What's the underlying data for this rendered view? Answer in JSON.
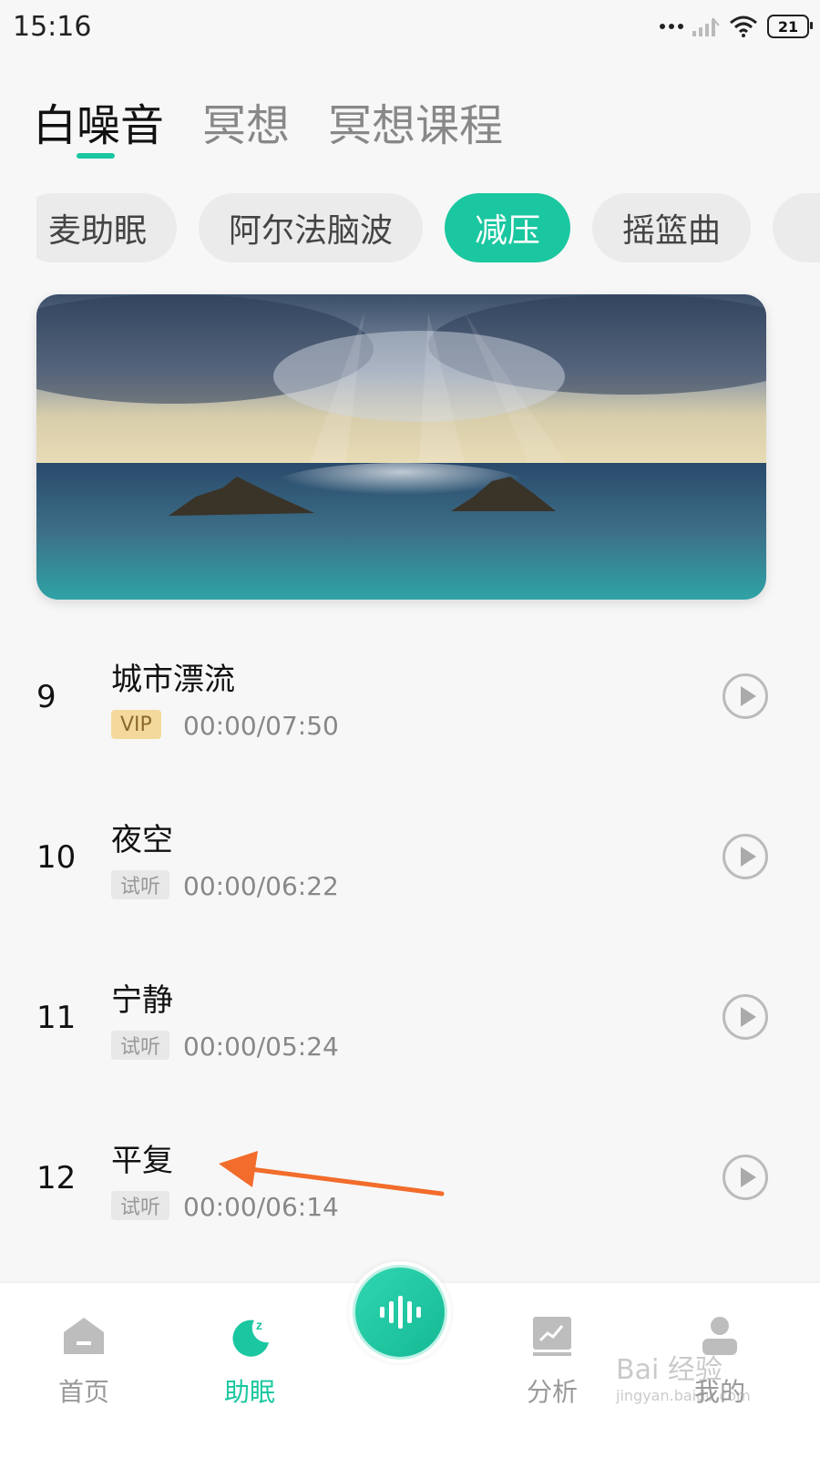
{
  "status_bar": {
    "time": "15:16",
    "battery": "21"
  },
  "top_tabs": [
    {
      "label": "白噪音",
      "active": true
    },
    {
      "label": "冥想",
      "active": false
    },
    {
      "label": "冥想课程",
      "active": false
    }
  ],
  "categories": [
    {
      "label": "麦助眠",
      "active": false
    },
    {
      "label": "阿尔法脑波",
      "active": false
    },
    {
      "label": "减压",
      "active": true
    },
    {
      "label": "摇篮曲",
      "active": false
    },
    {
      "label": "",
      "active": false
    }
  ],
  "tracks": [
    {
      "number": "9",
      "title": "城市漂流",
      "badge": "VIP",
      "badge_type": "vip",
      "time": "00:00/07:50"
    },
    {
      "number": "10",
      "title": "夜空",
      "badge": "试听",
      "badge_type": "trial",
      "time": "00:00/06:22"
    },
    {
      "number": "11",
      "title": "宁静",
      "badge": "试听",
      "badge_type": "trial",
      "time": "00:00/05:24"
    },
    {
      "number": "12",
      "title": "平复",
      "badge": "试听",
      "badge_type": "trial",
      "time": "00:00/06:14"
    }
  ],
  "bottom_nav": {
    "home": "首页",
    "sleep": "助眠",
    "analysis": "分析",
    "me": "我的"
  },
  "watermark": {
    "main": "Bai 经验",
    "sub": "jingyan.baidu.com"
  },
  "colors": {
    "accent": "#1ac7a0",
    "vip_badge": "#f4d99c",
    "arrow": "#f26c2b"
  }
}
